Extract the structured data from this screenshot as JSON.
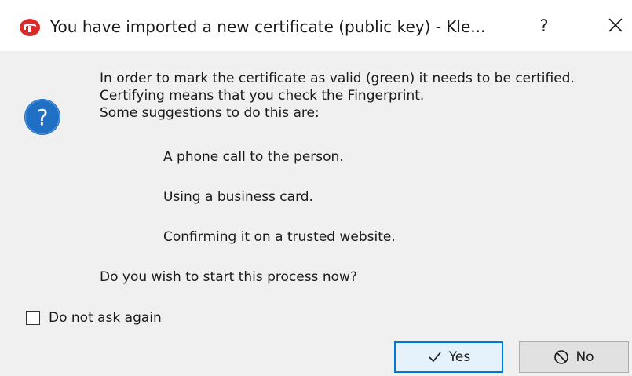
{
  "window": {
    "title": "You have imported a new certificate (public key) - Kle...",
    "help_label": "?",
    "app_icon": "kleopatra-app-icon",
    "close_icon": "close-icon"
  },
  "message": {
    "icon": "question-icon",
    "line1": "In order to mark the certificate as valid (green) it needs to be certified.",
    "line2": "Certifying means that you check the Fingerprint.",
    "line3": "Some suggestions to do this are:",
    "suggestions": [
      "A phone call to the person.",
      "Using a business card.",
      "Confirming it on a trusted website."
    ],
    "question": "Do you wish to start this process now?"
  },
  "options": {
    "dont_ask_label": "Do not ask again",
    "dont_ask_checked": false
  },
  "buttons": {
    "yes_label": "Yes",
    "no_label": "No",
    "yes_icon": "check-icon",
    "no_icon": "no-entry-icon"
  },
  "colors": {
    "accent": "#0078d7",
    "question_icon": "#1f6fc5",
    "app_icon": "#d92b2b"
  }
}
